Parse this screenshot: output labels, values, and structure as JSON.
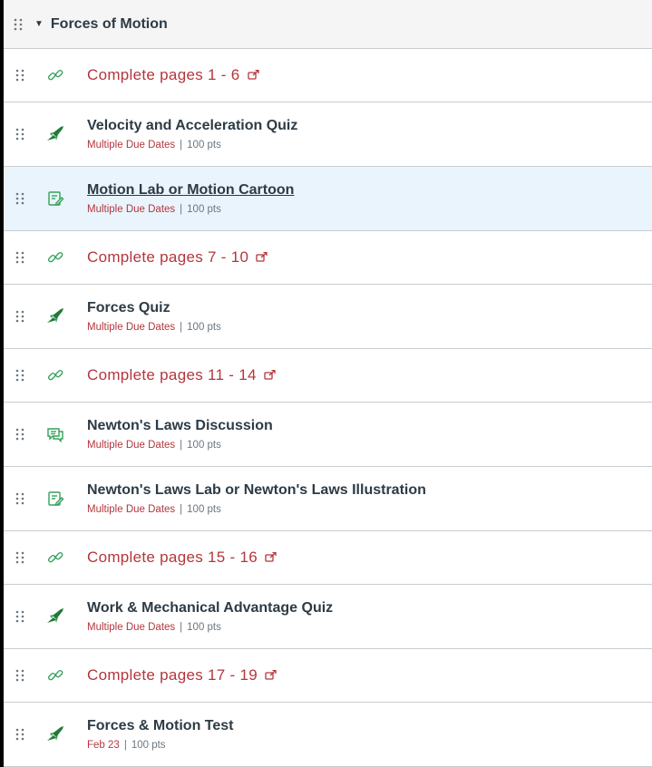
{
  "module": {
    "title": "Forces of Motion",
    "items": [
      {
        "kind": "link",
        "icon": "link-icon",
        "title": "Complete pages 1 - 6"
      },
      {
        "kind": "quiz",
        "icon": "quiz-rocket-icon",
        "title": "Velocity and Acceleration Quiz",
        "due": "Multiple Due Dates",
        "sep": "|",
        "points": "100 pts"
      },
      {
        "kind": "assignment",
        "icon": "assignment-icon",
        "title": "Motion Lab or Motion Cartoon",
        "due": "Multiple Due Dates",
        "sep": "|",
        "points": "100 pts",
        "active": true
      },
      {
        "kind": "link",
        "icon": "link-icon",
        "title": "Complete pages 7 - 10"
      },
      {
        "kind": "quiz",
        "icon": "quiz-rocket-icon",
        "title": "Forces Quiz",
        "due": "Multiple Due Dates",
        "sep": "|",
        "points": "100 pts"
      },
      {
        "kind": "link",
        "icon": "link-icon",
        "title": "Complete pages 11 - 14"
      },
      {
        "kind": "discussion",
        "icon": "discussion-icon",
        "title": "Newton's Laws Discussion",
        "due": "Multiple Due Dates",
        "sep": "|",
        "points": "100 pts"
      },
      {
        "kind": "assignment",
        "icon": "assignment-icon",
        "title": "Newton's Laws Lab or Newton's Laws Illustration",
        "due": "Multiple Due Dates",
        "sep": "|",
        "points": "100 pts"
      },
      {
        "kind": "link",
        "icon": "link-icon",
        "title": "Complete pages 15 - 16"
      },
      {
        "kind": "quiz",
        "icon": "quiz-rocket-icon",
        "title": "Work & Mechanical Advantage Quiz",
        "due": "Multiple Due Dates",
        "sep": "|",
        "points": "100 pts"
      },
      {
        "kind": "link",
        "icon": "link-icon",
        "title": "Complete pages 17 - 19"
      },
      {
        "kind": "quiz",
        "icon": "quiz-rocket-icon",
        "title": "Forces & Motion Test",
        "due": "Feb 23",
        "sep": "|",
        "points": "100 pts"
      }
    ]
  },
  "colors": {
    "link_red": "#b4363c",
    "text_dark": "#2d3b45",
    "meta_gray": "#6b7780",
    "quiz_green": "#1f7a35",
    "icon_green": "#35a15c",
    "active_bg": "#eaf4fd"
  }
}
